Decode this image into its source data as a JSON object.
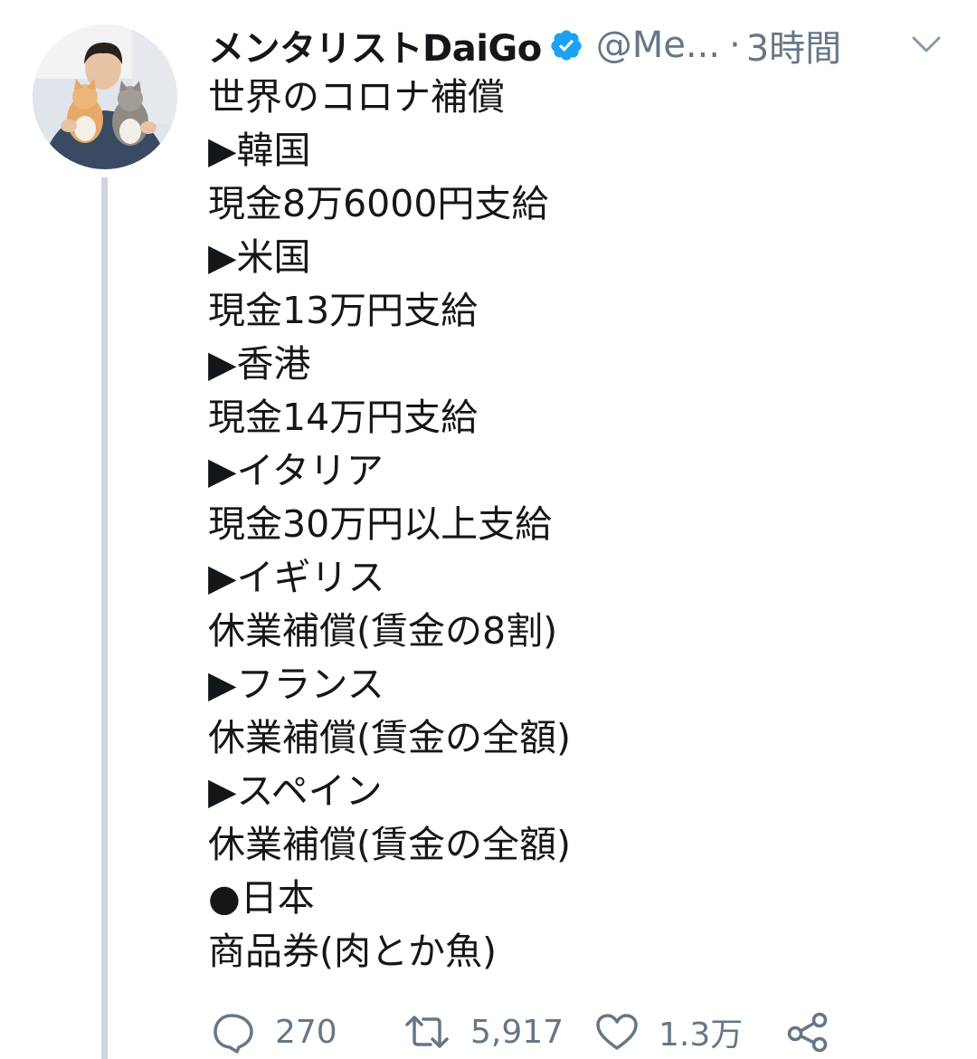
{
  "tweet": {
    "display_name": "メンタリストDaiGo",
    "handle": "@Me...",
    "separator": "·",
    "time": "3時間",
    "body_lines": [
      "世界のコロナ補償",
      "▶韓国",
      "現金8万6000円支給",
      "▶米国",
      "現金13万円支給",
      "▶香港",
      "現金14万円支給",
      "▶イタリア",
      "現金30万円以上支給",
      "▶イギリス",
      "休業補償(賃金の8割)",
      "▶フランス",
      "休業補償(賃金の全額)",
      "▶スペイン",
      "休業補償(賃金の全額)",
      "●日本",
      "商品券(肉とか魚)"
    ],
    "actions": {
      "reply_count": "270",
      "retweet_count": "5,917",
      "like_count": "1.3万"
    }
  },
  "icons": {
    "verified": "verified-badge-icon",
    "menu": "chevron-down-icon",
    "reply": "reply-icon",
    "retweet": "retweet-icon",
    "like": "heart-icon",
    "share": "share-icon"
  },
  "colors": {
    "text": "#14171a",
    "muted": "#657786",
    "verified": "#1da1f2",
    "thread_line": "#cdd6dd"
  }
}
